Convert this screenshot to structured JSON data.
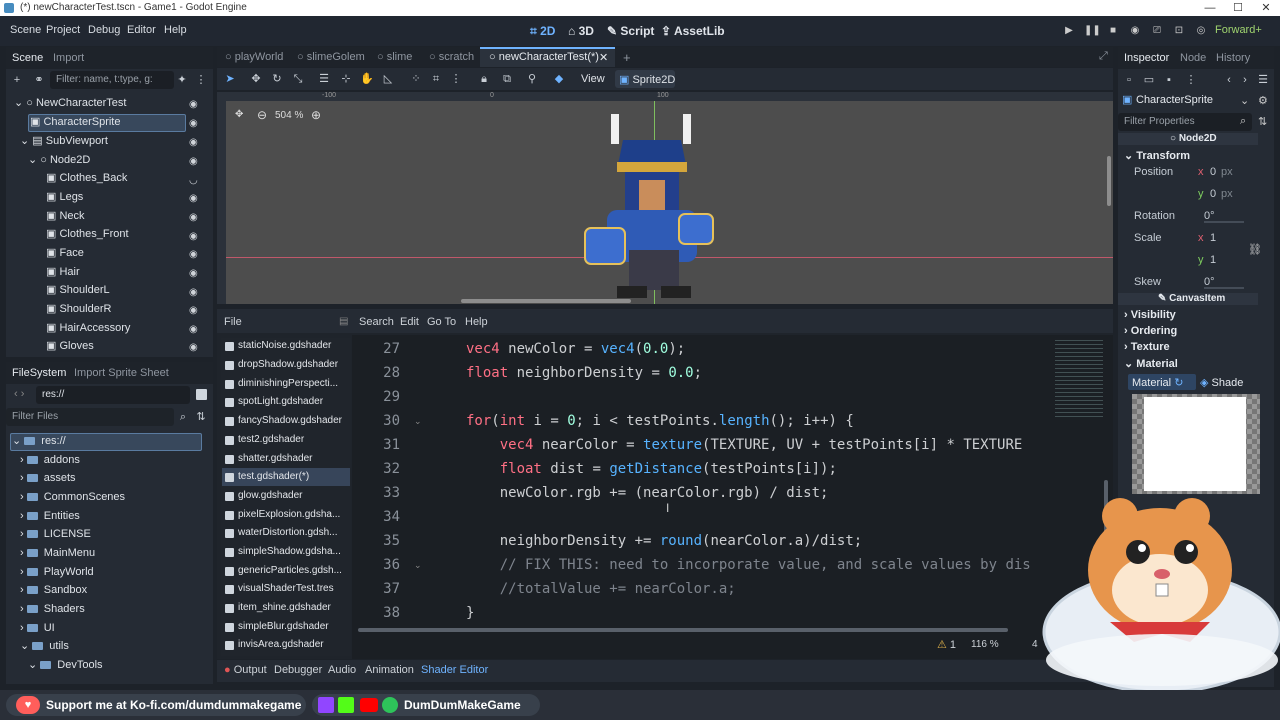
{
  "window": {
    "title": "(*) newCharacterTest.tscn - Game1 - Godot Engine",
    "min": "—",
    "max": "☐",
    "close": "✕"
  },
  "menu": {
    "items": [
      "Scene",
      "Project",
      "Debug",
      "Editor",
      "Help"
    ]
  },
  "workspaces": {
    "w2d": "2D",
    "w3d": "3D",
    "script": "Script",
    "assetlib": "AssetLib"
  },
  "renderer": "Forward+",
  "scene_dock": {
    "tab_scene": "Scene",
    "tab_import": "Import",
    "filter_placeholder": "Filter: name, t:type, g:",
    "nodes": [
      "NewCharacterTest",
      "CharacterSprite",
      "SubViewport",
      "Node2D",
      "Clothes_Back",
      "Legs",
      "Neck",
      "Clothes_Front",
      "Face",
      "Hair",
      "ShoulderL",
      "ShoulderR",
      "HairAccessory",
      "Gloves"
    ]
  },
  "filesystem": {
    "tab_fs": "FileSystem",
    "tab_import": "Import Sprite Sheet",
    "path": "res://",
    "filter_placeholder": "Filter Files",
    "items": [
      "res://",
      "addons",
      "assets",
      "CommonScenes",
      "Entities",
      "LICENSE",
      "MainMenu",
      "PlayWorld",
      "Sandbox",
      "Shaders",
      "UI",
      "utils",
      "DevTools"
    ]
  },
  "scene_tabs": [
    "playWorld",
    "slimeGolem",
    "slime",
    "scratch",
    "newCharacterTest(*)"
  ],
  "viewport": {
    "zoom": "504 %",
    "view": "View",
    "sprite2d": "Sprite2D",
    "ruler": [
      "-100",
      "0",
      "100"
    ]
  },
  "script_editor": {
    "menu": [
      "File",
      "Search",
      "Edit",
      "Go To",
      "Help"
    ],
    "scripts": [
      "staticNoise.gdshader",
      "dropShadow.gdshader",
      "diminishingPerspecti...",
      "spotLight.gdshader",
      "fancyShadow.gdshader",
      "test2.gdshader",
      "shatter.gdshader",
      "test.gdshader(*)",
      "glow.gdshader",
      "pixelExplosion.gdsha...",
      "waterDistortion.gdsh...",
      "simpleShadow.gdsha...",
      "genericParticles.gdsh...",
      "visualShaderTest.tres",
      "item_shine.gdshader",
      "simpleBlur.gdshader",
      "invisArea.gdshader"
    ],
    "line_numbers": [
      "27",
      "28",
      "29",
      "30",
      "31",
      "32",
      "33",
      "34",
      "35",
      "36",
      "37",
      "38"
    ],
    "status_warn": "1",
    "status_zoom": "116 %",
    "status_col": "4"
  },
  "bottom_tabs": [
    "Output",
    "Debugger",
    "Audio",
    "Animation",
    "Shader Editor"
  ],
  "inspector": {
    "tab_inspector": "Inspector",
    "tab_node": "Node",
    "tab_history": "History",
    "object": "CharacterSprite",
    "filter_placeholder": "Filter Properties",
    "class": "Node2D",
    "transform": "Transform",
    "position": "Position",
    "pos_x": "0",
    "pos_y": "0",
    "px": "px",
    "rotation": "Rotation",
    "rot_val": "0",
    "deg": "°",
    "scale": "Scale",
    "scale_x": "1",
    "scale_y": "1",
    "skew": "Skew",
    "skew_val": "0",
    "canvasitem": "CanvasItem",
    "visibility": "Visibility",
    "ordering": "Ordering",
    "texture": "Texture",
    "material": "Material",
    "mat_label": "Material",
    "shader_label": "Shade",
    "x": "x",
    "y": "y"
  },
  "banner": {
    "kofi": "Support me at Ko-fi.com/dumdummakegame",
    "channel": "DumDumMakeGame"
  }
}
